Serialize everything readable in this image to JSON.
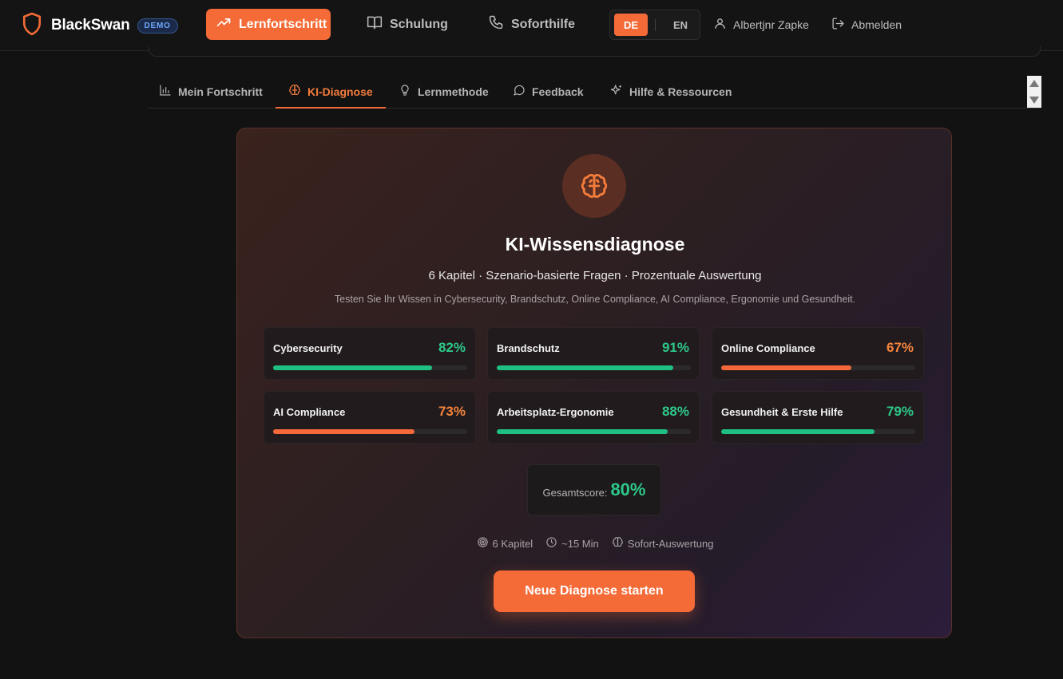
{
  "header": {
    "brand": "BlackSwan",
    "badge": "DEMO",
    "nav": [
      {
        "label": "Lernfortschritt",
        "icon": "trending-up-icon",
        "active": true
      },
      {
        "label": "Schulung",
        "icon": "book-open-icon",
        "active": false
      },
      {
        "label": "Soforthilfe",
        "icon": "phone-icon",
        "active": false
      }
    ],
    "lang": {
      "de": "DE",
      "en": "EN",
      "selected": "DE"
    },
    "user": "Albertjnr Zapke",
    "logout": "Abmelden"
  },
  "tabs": [
    {
      "label": "Mein Fortschritt",
      "icon": "bar-chart-icon",
      "active": false
    },
    {
      "label": "KI-Diagnose",
      "icon": "brain-icon",
      "active": true
    },
    {
      "label": "Lernmethode",
      "icon": "lightbulb-icon",
      "active": false
    },
    {
      "label": "Feedback",
      "icon": "message-circle-icon",
      "active": false
    },
    {
      "label": "Hilfe & Ressourcen",
      "icon": "sparkles-icon",
      "active": false
    }
  ],
  "diagnosis": {
    "icon": "brain-icon",
    "title": "KI-Wissensdiagnose",
    "subtitle": "6 Kapitel · Szenario-basierte Fragen · Prozentuale Auswertung",
    "description": "Testen Sie Ihr Wissen in Cybersecurity, Brandschutz, Online Compliance, AI Compliance, Ergonomie und Gesundheit.",
    "categories": [
      {
        "name": "Cybersecurity",
        "percent": 82,
        "percent_label": "82%",
        "status": "good"
      },
      {
        "name": "Brandschutz",
        "percent": 91,
        "percent_label": "91%",
        "status": "good"
      },
      {
        "name": "Online Compliance",
        "percent": 67,
        "percent_label": "67%",
        "status": "warn"
      },
      {
        "name": "AI Compliance",
        "percent": 73,
        "percent_label": "73%",
        "status": "warn"
      },
      {
        "name": "Arbeitsplatz-Ergonomie",
        "percent": 88,
        "percent_label": "88%",
        "status": "good"
      },
      {
        "name": "Gesundheit & Erste Hilfe",
        "percent": 79,
        "percent_label": "79%",
        "status": "good"
      }
    ],
    "total_label": "Gesamtscore:",
    "total_value": "80%",
    "meta": [
      {
        "icon": "target-icon",
        "label": "6 Kapitel"
      },
      {
        "icon": "clock-icon",
        "label": "~15 Min"
      },
      {
        "icon": "brain-icon",
        "label": "Sofort-Auswertung"
      }
    ],
    "start_button": "Neue Diagnose starten"
  },
  "colors": {
    "accent": "#f46b37",
    "good": "#2dc889",
    "warn": "#f4843c"
  }
}
